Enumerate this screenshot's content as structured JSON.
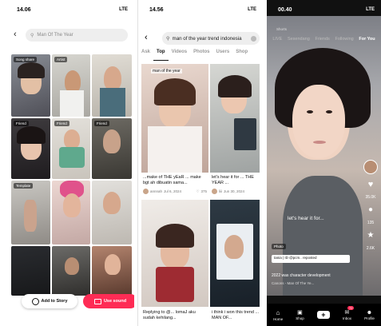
{
  "phone1": {
    "time": "14.06",
    "signal": "LTE",
    "search_placeholder": "Man Of The Year",
    "tiles": [
      "Song share",
      "Artist",
      "Friend",
      "Friend",
      "Friend",
      "Friend",
      "Template"
    ],
    "add_button": "Add to Story",
    "use_button": "Use sound"
  },
  "phone2": {
    "time": "14.56",
    "signal": "LTE",
    "search_query": "man of the year trend indonesia",
    "tabs": [
      "Ask",
      "Top",
      "Videos",
      "Photos",
      "Users",
      "Shop"
    ],
    "overlay_text": "man of the year",
    "card1_caption": "...make of THE yEaR ... make bgt ah dibuatin sama...",
    "card1_user": "annnah",
    "card1_date": "Jul 6, 2024",
    "card1_likes": "375",
    "card2_caption": "let's hear it for ... THE YEAR ...",
    "card2_user": "liii",
    "card2_date": "Jun 30, 2024",
    "card3_caption": "Replying to @... lomaJ aku sudah kehilang...",
    "card4_caption": "i think i won this trend ... MAN OF..."
  },
  "phone3": {
    "time": "00.40",
    "signal": "LTE",
    "live_label": "Shorts",
    "nav": [
      "LIVE",
      "Sesendang",
      "Friends",
      "Following",
      "For You"
    ],
    "video_text": "let's hear it for...",
    "photo_label": "Photo",
    "username": "tania | ID @pcm..  reposted",
    "caption": "2022 was character development",
    "sound": "Canons - Man Of The Ye...",
    "likes": "35.0K",
    "comments": "135",
    "saves": "2.6K",
    "shares": "1.4K",
    "bottom": [
      "Home",
      "Shop",
      "",
      "Inbox",
      "Profile"
    ],
    "inbox_badge": "72"
  }
}
